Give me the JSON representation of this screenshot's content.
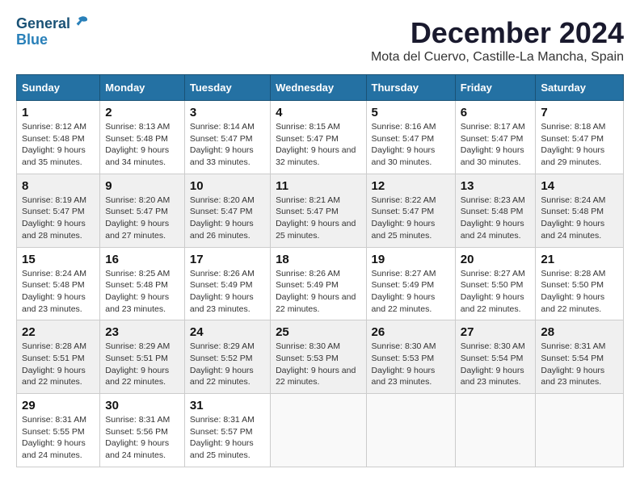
{
  "logo": {
    "general": "General",
    "blue": "Blue"
  },
  "title": "December 2024",
  "location": "Mota del Cuervo, Castille-La Mancha, Spain",
  "headers": [
    "Sunday",
    "Monday",
    "Tuesday",
    "Wednesday",
    "Thursday",
    "Friday",
    "Saturday"
  ],
  "weeks": [
    [
      {
        "day": "1",
        "info": "Sunrise: 8:12 AM\nSunset: 5:48 PM\nDaylight: 9 hours and 35 minutes."
      },
      {
        "day": "2",
        "info": "Sunrise: 8:13 AM\nSunset: 5:48 PM\nDaylight: 9 hours and 34 minutes."
      },
      {
        "day": "3",
        "info": "Sunrise: 8:14 AM\nSunset: 5:47 PM\nDaylight: 9 hours and 33 minutes."
      },
      {
        "day": "4",
        "info": "Sunrise: 8:15 AM\nSunset: 5:47 PM\nDaylight: 9 hours and 32 minutes."
      },
      {
        "day": "5",
        "info": "Sunrise: 8:16 AM\nSunset: 5:47 PM\nDaylight: 9 hours and 30 minutes."
      },
      {
        "day": "6",
        "info": "Sunrise: 8:17 AM\nSunset: 5:47 PM\nDaylight: 9 hours and 30 minutes."
      },
      {
        "day": "7",
        "info": "Sunrise: 8:18 AM\nSunset: 5:47 PM\nDaylight: 9 hours and 29 minutes."
      }
    ],
    [
      {
        "day": "8",
        "info": "Sunrise: 8:19 AM\nSunset: 5:47 PM\nDaylight: 9 hours and 28 minutes."
      },
      {
        "day": "9",
        "info": "Sunrise: 8:20 AM\nSunset: 5:47 PM\nDaylight: 9 hours and 27 minutes."
      },
      {
        "day": "10",
        "info": "Sunrise: 8:20 AM\nSunset: 5:47 PM\nDaylight: 9 hours and 26 minutes."
      },
      {
        "day": "11",
        "info": "Sunrise: 8:21 AM\nSunset: 5:47 PM\nDaylight: 9 hours and 25 minutes."
      },
      {
        "day": "12",
        "info": "Sunrise: 8:22 AM\nSunset: 5:47 PM\nDaylight: 9 hours and 25 minutes."
      },
      {
        "day": "13",
        "info": "Sunrise: 8:23 AM\nSunset: 5:48 PM\nDaylight: 9 hours and 24 minutes."
      },
      {
        "day": "14",
        "info": "Sunrise: 8:24 AM\nSunset: 5:48 PM\nDaylight: 9 hours and 24 minutes."
      }
    ],
    [
      {
        "day": "15",
        "info": "Sunrise: 8:24 AM\nSunset: 5:48 PM\nDaylight: 9 hours and 23 minutes."
      },
      {
        "day": "16",
        "info": "Sunrise: 8:25 AM\nSunset: 5:48 PM\nDaylight: 9 hours and 23 minutes."
      },
      {
        "day": "17",
        "info": "Sunrise: 8:26 AM\nSunset: 5:49 PM\nDaylight: 9 hours and 23 minutes."
      },
      {
        "day": "18",
        "info": "Sunrise: 8:26 AM\nSunset: 5:49 PM\nDaylight: 9 hours and 22 minutes."
      },
      {
        "day": "19",
        "info": "Sunrise: 8:27 AM\nSunset: 5:49 PM\nDaylight: 9 hours and 22 minutes."
      },
      {
        "day": "20",
        "info": "Sunrise: 8:27 AM\nSunset: 5:50 PM\nDaylight: 9 hours and 22 minutes."
      },
      {
        "day": "21",
        "info": "Sunrise: 8:28 AM\nSunset: 5:50 PM\nDaylight: 9 hours and 22 minutes."
      }
    ],
    [
      {
        "day": "22",
        "info": "Sunrise: 8:28 AM\nSunset: 5:51 PM\nDaylight: 9 hours and 22 minutes."
      },
      {
        "day": "23",
        "info": "Sunrise: 8:29 AM\nSunset: 5:51 PM\nDaylight: 9 hours and 22 minutes."
      },
      {
        "day": "24",
        "info": "Sunrise: 8:29 AM\nSunset: 5:52 PM\nDaylight: 9 hours and 22 minutes."
      },
      {
        "day": "25",
        "info": "Sunrise: 8:30 AM\nSunset: 5:53 PM\nDaylight: 9 hours and 22 minutes."
      },
      {
        "day": "26",
        "info": "Sunrise: 8:30 AM\nSunset: 5:53 PM\nDaylight: 9 hours and 23 minutes."
      },
      {
        "day": "27",
        "info": "Sunrise: 8:30 AM\nSunset: 5:54 PM\nDaylight: 9 hours and 23 minutes."
      },
      {
        "day": "28",
        "info": "Sunrise: 8:31 AM\nSunset: 5:54 PM\nDaylight: 9 hours and 23 minutes."
      }
    ],
    [
      {
        "day": "29",
        "info": "Sunrise: 8:31 AM\nSunset: 5:55 PM\nDaylight: 9 hours and 24 minutes."
      },
      {
        "day": "30",
        "info": "Sunrise: 8:31 AM\nSunset: 5:56 PM\nDaylight: 9 hours and 24 minutes."
      },
      {
        "day": "31",
        "info": "Sunrise: 8:31 AM\nSunset: 5:57 PM\nDaylight: 9 hours and 25 minutes."
      },
      {
        "day": "",
        "info": ""
      },
      {
        "day": "",
        "info": ""
      },
      {
        "day": "",
        "info": ""
      },
      {
        "day": "",
        "info": ""
      }
    ]
  ]
}
